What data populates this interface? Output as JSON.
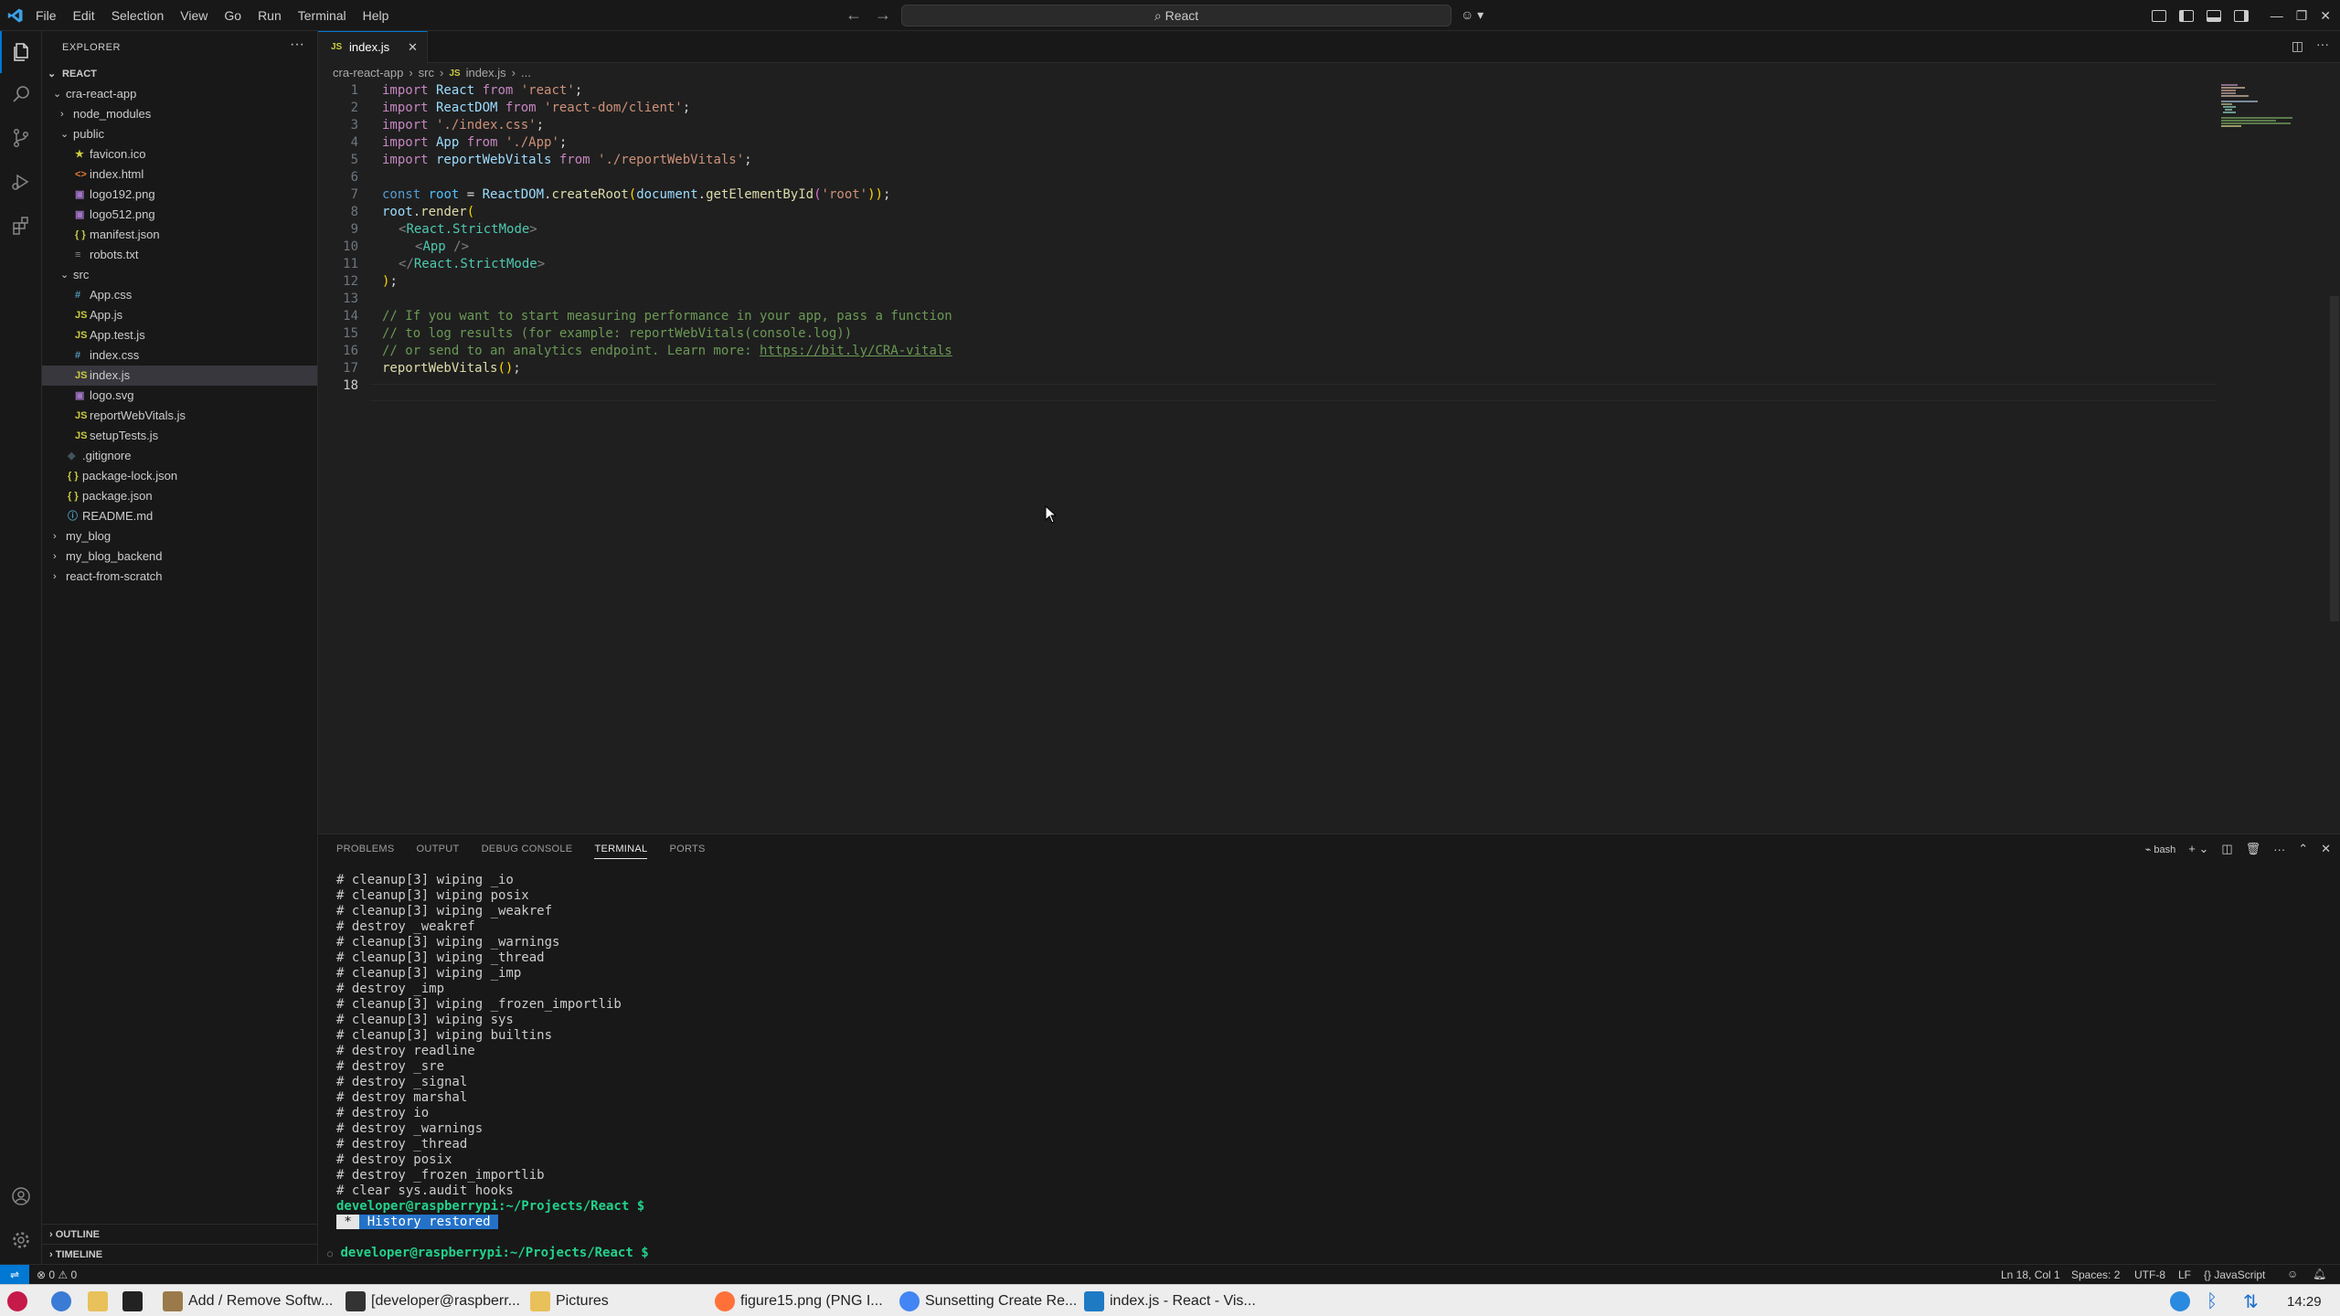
{
  "menu": [
    "File",
    "Edit",
    "Selection",
    "View",
    "Go",
    "Run",
    "Terminal",
    "Help"
  ],
  "command_center": "React",
  "sidebar": {
    "title": "EXPLORER",
    "root": "REACT",
    "tree": [
      {
        "label": "cra-react-app",
        "type": "folder-open",
        "depth": 1
      },
      {
        "label": "node_modules",
        "type": "folder",
        "depth": 2
      },
      {
        "label": "public",
        "type": "folder-open",
        "depth": 2
      },
      {
        "label": "favicon.ico",
        "type": "ico",
        "depth": 3
      },
      {
        "label": "index.html",
        "type": "html",
        "depth": 3
      },
      {
        "label": "logo192.png",
        "type": "img",
        "depth": 3
      },
      {
        "label": "logo512.png",
        "type": "img",
        "depth": 3
      },
      {
        "label": "manifest.json",
        "type": "json",
        "depth": 3
      },
      {
        "label": "robots.txt",
        "type": "txt",
        "depth": 3
      },
      {
        "label": "src",
        "type": "folder-open",
        "depth": 2
      },
      {
        "label": "App.css",
        "type": "css",
        "depth": 3
      },
      {
        "label": "App.js",
        "type": "js",
        "depth": 3
      },
      {
        "label": "App.test.js",
        "type": "js",
        "depth": 3
      },
      {
        "label": "index.css",
        "type": "css",
        "depth": 3
      },
      {
        "label": "index.js",
        "type": "js",
        "depth": 3,
        "selected": true
      },
      {
        "label": "logo.svg",
        "type": "img",
        "depth": 3
      },
      {
        "label": "reportWebVitals.js",
        "type": "js",
        "depth": 3
      },
      {
        "label": "setupTests.js",
        "type": "js",
        "depth": 3
      },
      {
        "label": ".gitignore",
        "type": "git",
        "depth": 2
      },
      {
        "label": "package-lock.json",
        "type": "json",
        "depth": 2
      },
      {
        "label": "package.json",
        "type": "json",
        "depth": 2
      },
      {
        "label": "README.md",
        "type": "info",
        "depth": 2
      },
      {
        "label": "my_blog",
        "type": "folder",
        "depth": 1
      },
      {
        "label": "my_blog_backend",
        "type": "folder",
        "depth": 1
      },
      {
        "label": "react-from-scratch",
        "type": "folder",
        "depth": 1
      }
    ],
    "outline": "OUTLINE",
    "timeline": "TIMELINE"
  },
  "editor": {
    "tab": "index.js",
    "tab_icon": "JS",
    "breadcrumb": [
      "cra-react-app",
      "src",
      "index.js",
      "..."
    ],
    "lines": [
      "1",
      "2",
      "3",
      "4",
      "5",
      "6",
      "7",
      "8",
      "9",
      "10",
      "11",
      "12",
      "13",
      "14",
      "15",
      "16",
      "17",
      "18"
    ],
    "code": {
      "l1": [
        "import",
        " React ",
        "from",
        " 'react'",
        ";"
      ],
      "l2": [
        "import",
        " ReactDOM ",
        "from",
        " 'react-dom/client'",
        ";"
      ],
      "l3": [
        "import",
        " './index.css'",
        ";"
      ],
      "l4": [
        "import",
        " App ",
        "from",
        " './App'",
        ";"
      ],
      "l5": [
        "import",
        " reportWebVitals ",
        "from",
        " './reportWebVitals'",
        ";"
      ],
      "l7": [
        "const",
        " root ",
        "= ",
        "ReactDOM",
        ".",
        "createRoot",
        "(",
        "document",
        ".",
        "getElementById",
        "(",
        "'root'",
        "))",
        ";"
      ],
      "l8": [
        "root",
        ".",
        "render",
        "("
      ],
      "l9": [
        "<",
        "React.StrictMode",
        ">"
      ],
      "l10": [
        "<",
        "App",
        " />"
      ],
      "l11": [
        "</",
        "React.StrictMode",
        ">"
      ],
      "l12": [
        ")",
        ";"
      ],
      "l14": "// If you want to start measuring performance in your app, pass a function",
      "l15": "// to log results (for example: reportWebVitals(console.log))",
      "l16a": "// or send to an analytics endpoint. Learn more: ",
      "l16b": "https://bit.ly/CRA-vitals",
      "l17": [
        "reportWebVitals",
        "()",
        ";"
      ]
    }
  },
  "panel": {
    "tabs": [
      "PROBLEMS",
      "OUTPUT",
      "DEBUG CONSOLE",
      "TERMINAL",
      "PORTS"
    ],
    "active_tab": "TERMINAL",
    "shell": "bash",
    "terminal_lines": [
      "# cleanup[3] wiping _io",
      "# cleanup[3] wiping posix",
      "# cleanup[3] wiping _weakref",
      "# destroy _weakref",
      "# cleanup[3] wiping _warnings",
      "# cleanup[3] wiping _thread",
      "# cleanup[3] wiping _imp",
      "# destroy _imp",
      "# cleanup[3] wiping _frozen_importlib",
      "# cleanup[3] wiping sys",
      "# cleanup[3] wiping builtins",
      "# destroy readline",
      "# destroy _sre",
      "# destroy _signal",
      "# destroy marshal",
      "# destroy io",
      "# destroy _warnings",
      "# destroy _thread",
      "# destroy posix",
      "# destroy _frozen_importlib",
      "# clear sys.audit hooks"
    ],
    "prompt1": "developer@raspberrypi:~/Projects/React $",
    "history_star": " * ",
    "history": " History restored ",
    "prompt2": "developer@raspberrypi:~/Projects/React $"
  },
  "statusbar": {
    "errors": "0",
    "warnings": "0",
    "position": "Ln 18, Col 1",
    "spaces": "Spaces: 2",
    "encoding": "UTF-8",
    "eol": "LF",
    "language": "JavaScript"
  },
  "taskbar": {
    "items": [
      {
        "label": "Add / Remove Softw...",
        "icon": "package-icon"
      },
      {
        "label": "[developer@raspberr...",
        "icon": "terminal-icon"
      },
      {
        "label": "Pictures",
        "icon": "folder-icon"
      },
      {
        "label": "figure15.png (PNG I...",
        "icon": "firefox-icon"
      },
      {
        "label": "Sunsetting Create Re...",
        "icon": "chromium-icon"
      },
      {
        "label": "index.js - React - Vis...",
        "icon": "vscode-icon"
      }
    ],
    "clock": "14:29"
  },
  "colors": {
    "accent": "#0078d4",
    "prompt": "#23d18b",
    "history_bg": "#2472c8"
  }
}
